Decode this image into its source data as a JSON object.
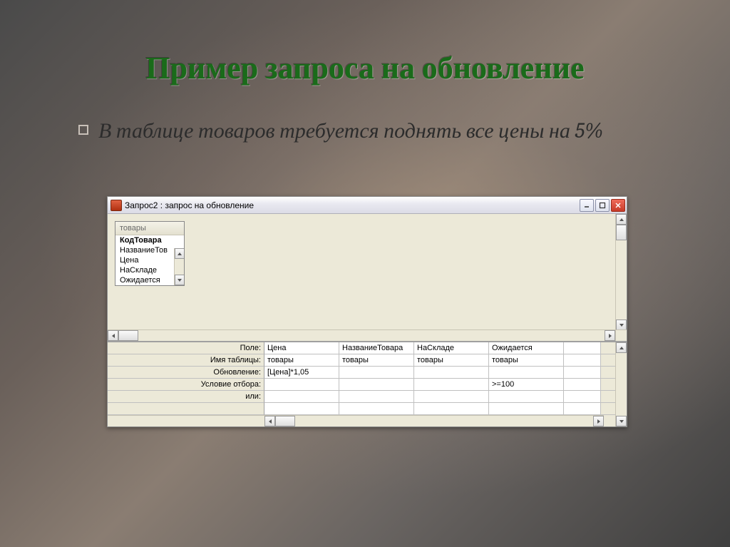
{
  "slide": {
    "title": "Пример запроса на обновление",
    "bullet": "В таблице товаров требуется поднять все цены на 5%"
  },
  "window": {
    "title": "Запрос2 : запрос на обновление",
    "field_list": {
      "caption": "товары",
      "fields": [
        "КодТовара",
        "НазваниеТов",
        "Цена",
        "НаСкладе",
        "Ожидается"
      ]
    },
    "grid": {
      "row_labels": [
        "Поле:",
        "Имя таблицы:",
        "Обновление:",
        "Условие отбора:",
        "или:"
      ],
      "columns": [
        {
          "field": "Цена",
          "table": "товары",
          "update": "[Цена]*1,05",
          "criteria": "",
          "or": ""
        },
        {
          "field": "НазваниеТовара",
          "table": "товары",
          "update": "",
          "criteria": "",
          "or": ""
        },
        {
          "field": "НаСкладе",
          "table": "товары",
          "update": "",
          "criteria": "",
          "or": ""
        },
        {
          "field": "Ожидается",
          "table": "товары",
          "update": "",
          "criteria": ">=100",
          "or": ""
        }
      ]
    }
  }
}
